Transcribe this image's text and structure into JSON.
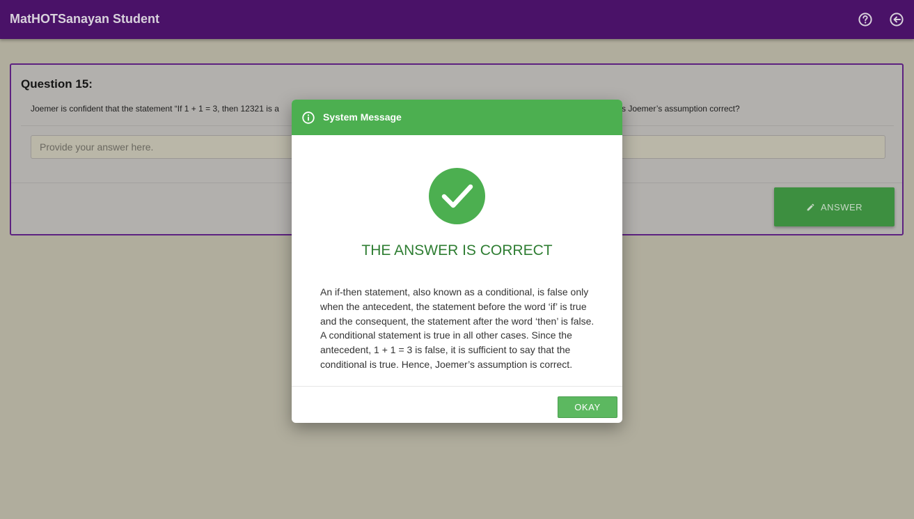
{
  "appbar": {
    "title": "MatHOTSanayan Student",
    "icons": [
      "help-icon",
      "back-icon"
    ]
  },
  "question": {
    "title": "Question 15:",
    "text": "Joemer is confident that the statement “If 1 + 1 = 3, then 12321 is a",
    "text_tail": "s Joemer’s assumption correct?",
    "answer_placeholder": "Provide your answer here.",
    "answer_button_label": "ANSWER"
  },
  "modal": {
    "header_title": "System Message",
    "result_title": "THE ANSWER IS CORRECT",
    "explanation": "An if-then statement, also known as a conditional, is false only when the antecedent, the statement before the word ‘if’ is true and the consequent, the statement after the word ‘then’ is false. A conditional statement is true in all other cases. Since the antecedent, 1 + 1 = 3 is false, it is sufficient to say that the conditional is true. Hence, Joemer’s assumption is correct.",
    "okay_label": "OKAY"
  },
  "colors": {
    "appbar": "#4a1268",
    "success": "#4caf50",
    "success_text": "#2e7d32",
    "backdrop": "#b0ad9d"
  }
}
